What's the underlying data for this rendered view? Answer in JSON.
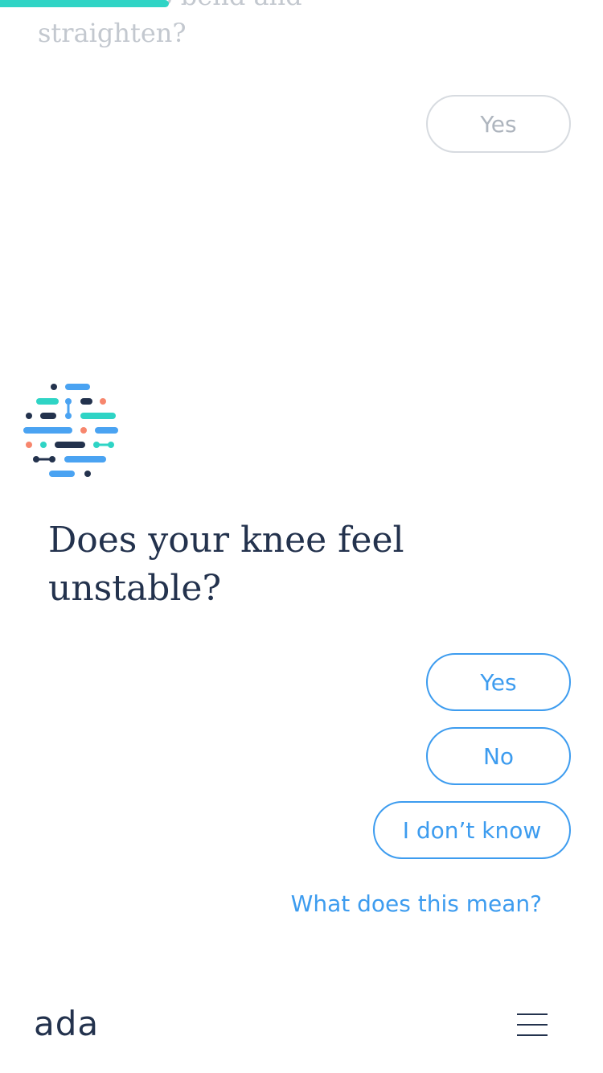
{
  "progress": {
    "fraction": 0.28,
    "color": "#2fd4c5"
  },
  "previous_question": {
    "text": "difficult to bend and straighten?",
    "answer_label": "Yes"
  },
  "avatar": {
    "icon": "ada-dots-logo-icon"
  },
  "question": {
    "text": "Does your knee feel unstable?"
  },
  "answers": [
    {
      "label": "Yes"
    },
    {
      "label": "No"
    },
    {
      "label": "I don’t know"
    }
  ],
  "help_link": {
    "label": "What does this mean?"
  },
  "footer": {
    "brand": "ada",
    "menu_icon": "hamburger-menu-icon"
  },
  "colors": {
    "accent_blue": "#3d9cef",
    "navy": "#23324d",
    "teal": "#2fd4c5",
    "coral": "#f7866d",
    "muted_gray": "#c3c8cf"
  }
}
